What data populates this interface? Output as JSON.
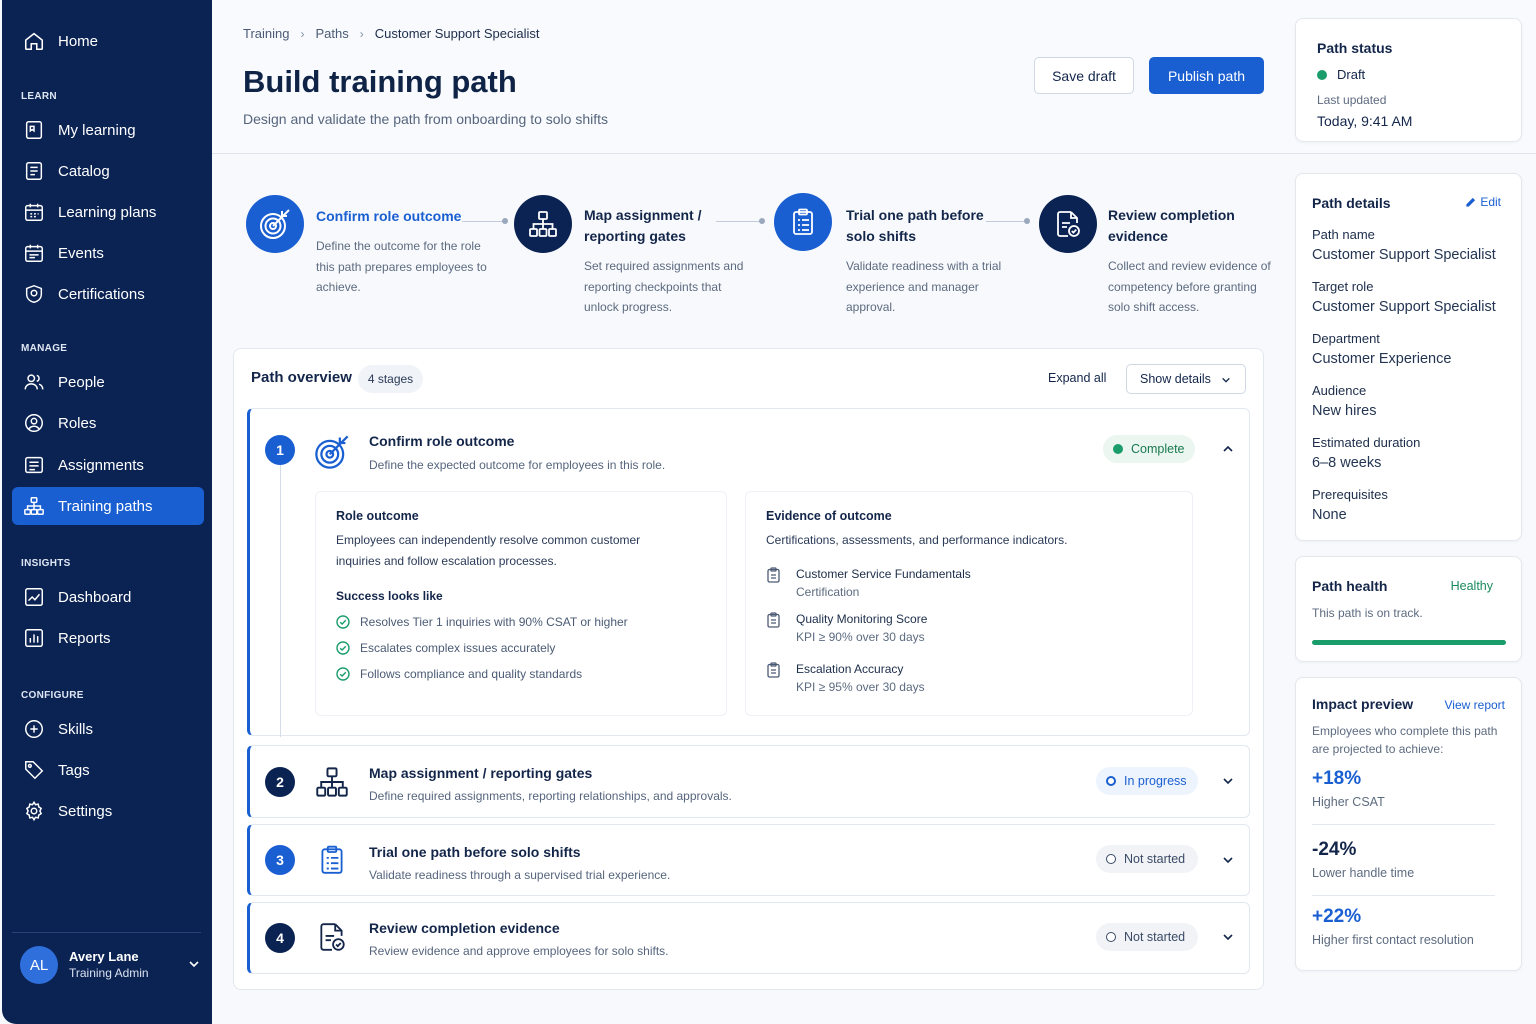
{
  "sidebar": {
    "items": [
      {
        "label": "Home",
        "icon": "home-icon"
      },
      {
        "label": "My learning",
        "icon": "my-learning-icon"
      },
      {
        "label": "Catalog",
        "icon": "catalog-icon"
      },
      {
        "label": "Learning plans",
        "icon": "calendar-grid-icon"
      },
      {
        "label": "Events",
        "icon": "calendar-icon"
      },
      {
        "label": "Certifications",
        "icon": "shield-icon"
      },
      {
        "label": "People",
        "icon": "people-icon"
      },
      {
        "label": "Roles",
        "icon": "user-circle-icon"
      },
      {
        "label": "Assignments",
        "icon": "list-icon"
      },
      {
        "label": "Training paths",
        "icon": "hierarchy-icon",
        "active": true
      },
      {
        "label": "Dashboard",
        "icon": "chart-line-icon"
      },
      {
        "label": "Reports",
        "icon": "bar-chart-icon"
      },
      {
        "label": "Skills",
        "icon": "skills-icon"
      },
      {
        "label": "Tags",
        "icon": "tag-icon"
      },
      {
        "label": "Settings",
        "icon": "gear-icon"
      }
    ],
    "sections": {
      "learn": "LEARN",
      "manage": "MANAGE",
      "insights": "INSIGHTS",
      "configure": "CONFIGURE"
    },
    "user": {
      "initials": "AL",
      "name": "Avery Lane",
      "role": "Training Admin"
    }
  },
  "header": {
    "breadcrumb": [
      "Training",
      "Paths",
      "Customer Support Specialist"
    ],
    "title": "Build training path",
    "subtitle": "Design and validate the path from onboarding to solo shifts",
    "save_label": "Save draft",
    "publish_label": "Publish path"
  },
  "status": {
    "title": "Path status",
    "state": "Draft",
    "updated_label": "Last updated",
    "updated_value": "Today, 9:41 AM"
  },
  "details": {
    "title": "Path details",
    "edit_label": "Edit",
    "fields": [
      {
        "label": "Path name",
        "value": "Customer Support Specialist"
      },
      {
        "label": "Target role",
        "value": "Customer Support Specialist"
      },
      {
        "label": "Department",
        "value": "Customer Experience"
      },
      {
        "label": "Audience",
        "value": "New hires"
      },
      {
        "label": "Estimated duration",
        "value": "6–8 weeks"
      },
      {
        "label": "Prerequisites",
        "value": "None"
      }
    ]
  },
  "health": {
    "title": "Path health",
    "state": "Healthy",
    "text": "This path is on track.",
    "progress": 1.0
  },
  "impact": {
    "title": "Impact preview",
    "link": "View report",
    "intro": "Employees who complete this path are projected to achieve:",
    "metrics": [
      {
        "value": "+18%",
        "label": "Higher CSAT"
      },
      {
        "value": "-24%",
        "label": "Lower handle time"
      },
      {
        "value": "+22%",
        "label": "Higher first contact resolution"
      }
    ]
  },
  "stepper": [
    {
      "title": "Confirm role outcome",
      "desc": "Define the outcome for the role this path prepares employees to achieve."
    },
    {
      "title": "Map assignment / reporting gates",
      "desc": "Set required assignments and reporting checkpoints that unlock progress."
    },
    {
      "title": "Trial one path before solo shifts",
      "desc": "Validate readiness with a trial experience and manager approval."
    },
    {
      "title": "Review completion evidence",
      "desc": "Collect and review evidence of competency before granting solo shift access."
    }
  ],
  "overview": {
    "title": "Path overview",
    "count": "4 stages",
    "expand_all": "Expand all",
    "show_details": "Show details",
    "stages": [
      {
        "num": "1",
        "title": "Confirm role outcome",
        "desc": "Define the expected outcome for employees in this role.",
        "status": "Complete"
      },
      {
        "num": "2",
        "title": "Map assignment / reporting gates",
        "desc": "Define required assignments, reporting relationships, and approvals.",
        "status": "In progress"
      },
      {
        "num": "3",
        "title": "Trial one path before solo shifts",
        "desc": "Validate readiness through a supervised trial experience.",
        "status": "Not started"
      },
      {
        "num": "4",
        "title": "Review completion evidence",
        "desc": "Review evidence and approve employees for solo shifts.",
        "status": "Not started"
      }
    ],
    "role_outcome": {
      "heading": "Role outcome",
      "text": "Employees can independently resolve common customer inquiries and follow escalation processes.",
      "success_heading": "Success looks like",
      "success": [
        "Resolves Tier 1 inquiries with 90% CSAT or higher",
        "Escalates complex issues accurately",
        "Follows compliance and quality standards"
      ]
    },
    "evidence": {
      "heading": "Evidence of outcome",
      "text": "Certifications, assessments, and performance indicators.",
      "items": [
        {
          "name": "Customer Service Fundamentals",
          "sub": "Certification"
        },
        {
          "name": "Quality Monitoring Score",
          "sub": "KPI ≥ 90% over 30 days"
        },
        {
          "name": "Escalation Accuracy",
          "sub": "KPI ≥ 95% over 30 days"
        }
      ]
    }
  },
  "colors": {
    "navy": "#0b2353",
    "accent": "#1a5fd1",
    "green": "#1a9d6a"
  }
}
